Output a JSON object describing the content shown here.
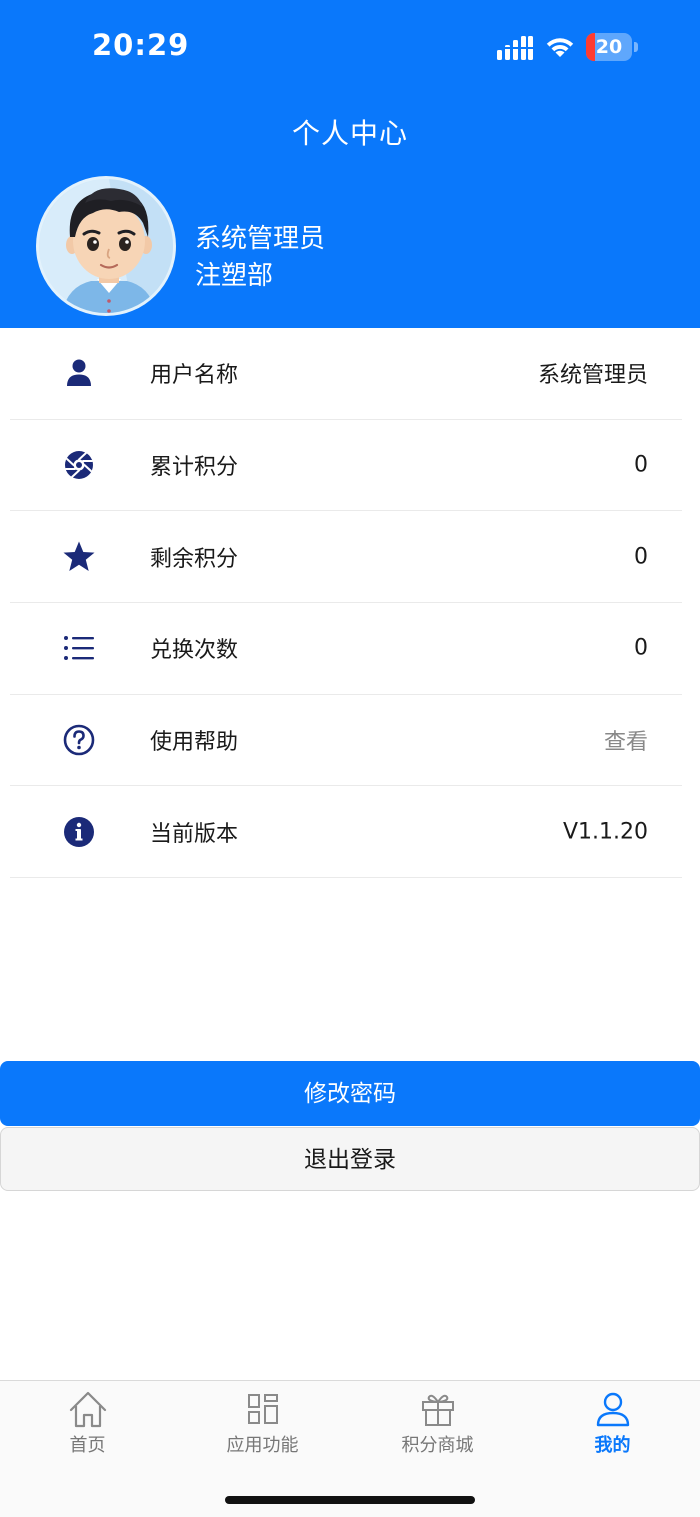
{
  "status_bar": {
    "time": "20:29",
    "battery_level": "20",
    "battery_fraction": 0.2,
    "battery_color": "#FF3B30"
  },
  "header": {
    "title": "个人中心",
    "user_name": "系统管理员",
    "department": "注塑部",
    "background_color": "#0A78FB"
  },
  "info_list": {
    "items": [
      {
        "icon": "user-icon",
        "label": "用户名称",
        "value": "系统管理员"
      },
      {
        "icon": "aperture-icon",
        "label": "累计积分",
        "value": "0"
      },
      {
        "icon": "star-icon",
        "label": "剩余积分",
        "value": "0"
      },
      {
        "icon": "list-icon",
        "label": "兑换次数",
        "value": "0"
      },
      {
        "icon": "help-icon",
        "label": "使用帮助",
        "value": "查看"
      },
      {
        "icon": "info-icon",
        "label": "当前版本",
        "value": "V1.1.20"
      }
    ],
    "icon_color": "#1B2A78"
  },
  "actions": {
    "change_password_label": "修改密码",
    "logout_label": "退出登录"
  },
  "tab_bar": {
    "tabs": [
      {
        "icon": "home-icon",
        "label": "首页",
        "active": false
      },
      {
        "icon": "grid-icon",
        "label": "应用功能",
        "active": false
      },
      {
        "icon": "gift-icon",
        "label": "积分商城",
        "active": false
      },
      {
        "icon": "profile-icon",
        "label": "我的",
        "active": true
      }
    ],
    "active_color": "#0A78FB"
  }
}
